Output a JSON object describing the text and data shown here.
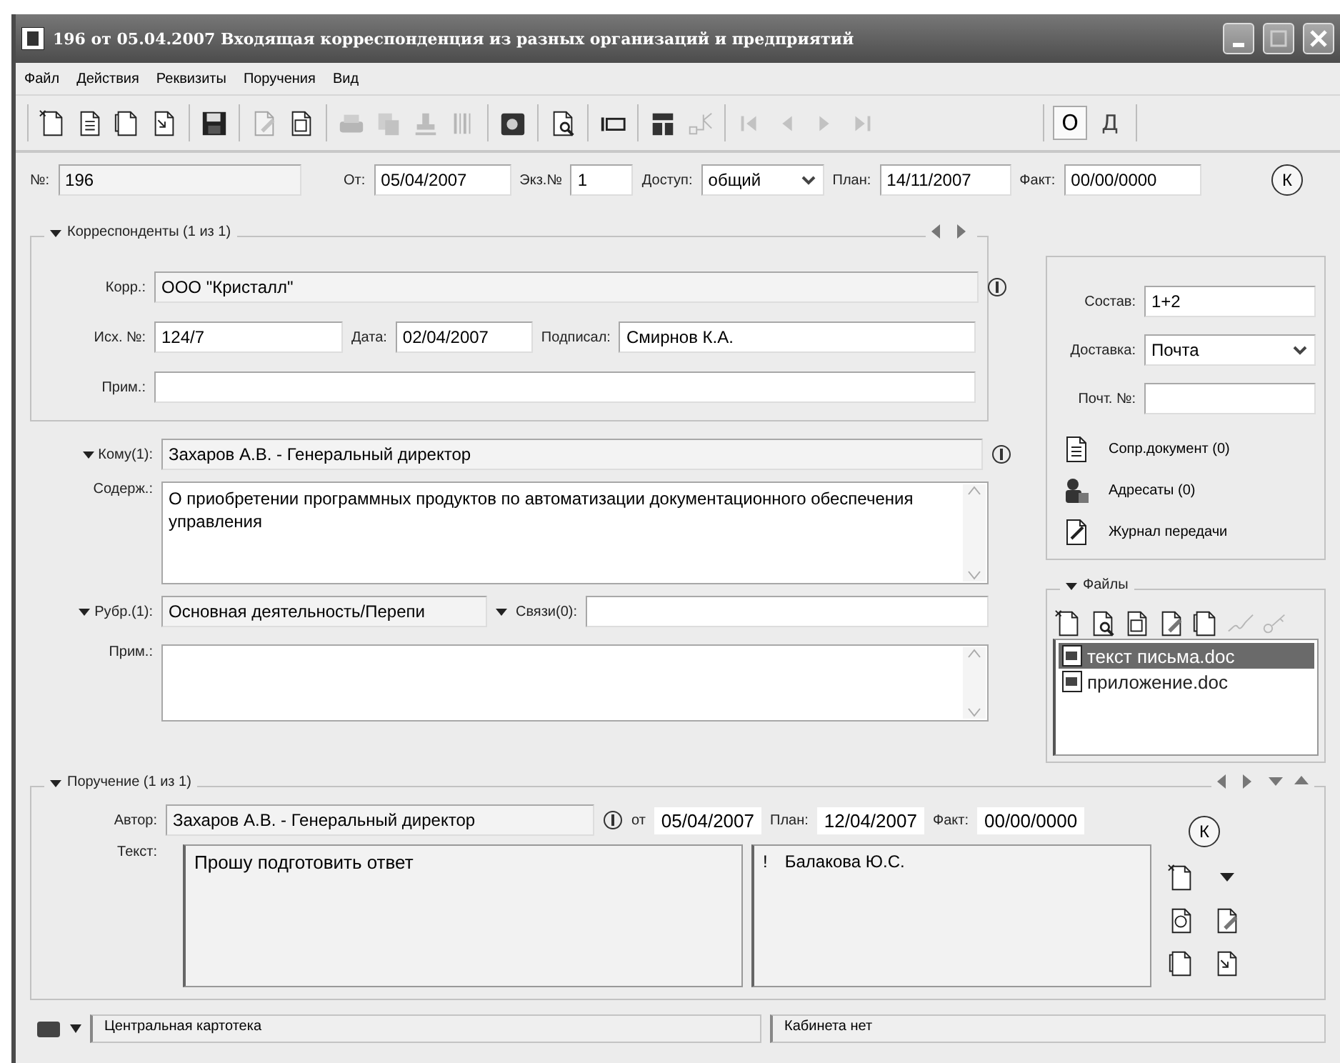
{
  "window": {
    "title": "196 от 05.04.2007 Входящая корреспонденция из разных организаций и предприятий"
  },
  "menu": [
    "Файл",
    "Действия",
    "Реквизиты",
    "Поручения",
    "Вид"
  ],
  "toolbar": {
    "groups": [
      {
        "buttons": [
          {
            "disabled": false
          },
          {
            "disabled": false
          },
          {
            "disabled": false
          },
          {
            "disabled": false
          }
        ]
      },
      {
        "buttons": [
          {
            "disabled": false
          }
        ]
      },
      {
        "buttons": [
          {
            "disabled": true
          },
          {
            "disabled": false
          }
        ]
      },
      {
        "buttons": [
          {
            "disabled": true
          },
          {
            "disabled": true
          },
          {
            "disabled": true
          },
          {
            "disabled": true
          }
        ]
      },
      {
        "buttons": [
          {
            "disabled": false
          }
        ]
      },
      {
        "buttons": [
          {
            "disabled": false
          }
        ]
      },
      {
        "buttons": [
          {
            "disabled": false
          }
        ]
      },
      {
        "buttons": [
          {
            "disabled": false
          },
          {
            "disabled": true
          }
        ]
      },
      {
        "buttons": [
          {
            "disabled": true
          },
          {
            "disabled": true
          },
          {
            "disabled": true
          },
          {
            "disabled": true
          }
        ]
      }
    ],
    "toggles": [
      {
        "label": "О",
        "selected": true
      },
      {
        "label": "Д",
        "selected": false
      }
    ]
  },
  "header": {
    "number": {
      "label": "№:",
      "value": "196"
    },
    "date": {
      "label": "От:",
      "value": "05/04/2007"
    },
    "copy": {
      "label": "Экз.№",
      "value": "1"
    },
    "access": {
      "label": "Доступ:",
      "value": "общий"
    },
    "plan": {
      "label": "План:",
      "value": "14/11/2007"
    },
    "fact": {
      "label": "Факт:",
      "value": "00/00/0000"
    },
    "k_button": "К"
  },
  "correspondents": {
    "title": "Корреспонденты (1 из 1)",
    "expanded": true,
    "corr": {
      "label": "Корр.:",
      "value": "ООО \"Кристалл\""
    },
    "out_no": {
      "label": "Исх. №:",
      "value": "124/7"
    },
    "date": {
      "label": "Дата:",
      "value": "02/04/2007"
    },
    "signed": {
      "label": "Подписал:",
      "value": "Смирнов К.А."
    },
    "note": {
      "label": "Прим.:"
    }
  },
  "addressee": {
    "label": "Кому(1):",
    "expanded": true,
    "value": "Захаров А.В. - Генеральный директор"
  },
  "content": {
    "label": "Содерж.:",
    "value": "О приобретении программных продуктов по автоматизации документационного обеспечения управления"
  },
  "rubric": {
    "label": "Рубр.(1):",
    "expanded": true,
    "value": "Основная деятельность/Перепи"
  },
  "links": {
    "label": "Связи(0):",
    "expanded": true
  },
  "note": {
    "label": "Прим.:"
  },
  "side": {
    "composition": {
      "label": "Состав:",
      "value": "1+2"
    },
    "delivery": {
      "label": "Доставка:",
      "value": "Почта"
    },
    "post_no": {
      "label": "Почт. №:"
    },
    "actions": [
      "Сопр.документ (0)",
      "Адресаты (0)",
      "Журнал передачи"
    ]
  },
  "files": {
    "title": "Файлы",
    "expanded": true,
    "tools": [
      {
        "disabled": false
      },
      {
        "disabled": false
      },
      {
        "disabled": false
      },
      {
        "disabled": false
      },
      {
        "disabled": false
      },
      {
        "disabled": true
      },
      {
        "disabled": true
      }
    ],
    "items": [
      {
        "name": "текст письма.doc",
        "selected": true
      },
      {
        "name": "приложение.doc",
        "selected": false
      }
    ]
  },
  "assignment": {
    "title": "Поручение (1 из 1)",
    "expanded": true,
    "author": {
      "label": "Автор:",
      "value": "Захаров А.В. - Генеральный директор"
    },
    "from": {
      "label": "от",
      "value": "05/04/2007"
    },
    "plan": {
      "label": "План:",
      "value": "12/04/2007"
    },
    "fact": {
      "label": "Факт:",
      "value": "00/00/0000"
    },
    "text": {
      "label": "Текст:",
      "value": "Прошу подготовить ответ"
    },
    "executors": [
      {
        "mark": "!",
        "name": "Балакова Ю.С."
      }
    ],
    "k_button": "К"
  },
  "status_bar": [
    "Центральная картотека",
    "Кабинета нет"
  ]
}
